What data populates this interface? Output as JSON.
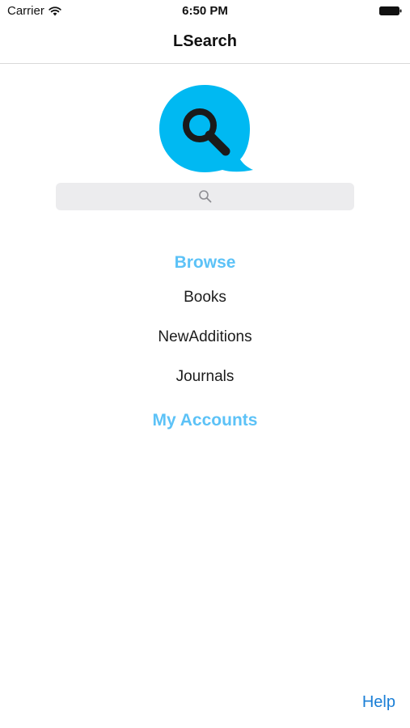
{
  "status_bar": {
    "carrier": "Carrier",
    "time": "6:50 PM",
    "wifi_icon": "wifi-icon",
    "battery_icon": "battery-icon"
  },
  "nav": {
    "title": "LSearch"
  },
  "logo": {
    "icon": "magnifier-speech-bubble-icon",
    "color": "#00b9f2"
  },
  "search": {
    "placeholder": "",
    "value": "",
    "icon": "search-icon"
  },
  "menu": {
    "browse_heading": "Browse",
    "items": [
      {
        "label": "Books"
      },
      {
        "label": "NewAdditions"
      },
      {
        "label": "Journals"
      }
    ],
    "accounts_heading": "My Accounts"
  },
  "footer": {
    "help_label": "Help"
  },
  "colors": {
    "heading": "#5cc2f7",
    "link": "#1b7fd6",
    "search_bg": "#ececee"
  }
}
